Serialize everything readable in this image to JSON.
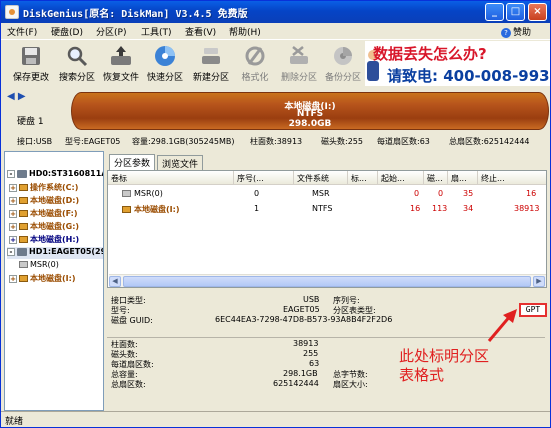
{
  "window": {
    "title": "DiskGenius[原名: DiskMan] V3.4.5 免费版",
    "controls": {
      "minimize": "_",
      "maximize": "□",
      "close": "×"
    }
  },
  "menu": {
    "items": [
      "文件(F)",
      "硬盘(D)",
      "分区(P)",
      "工具(T)",
      "查看(V)",
      "帮助(H)"
    ],
    "help_label": "赞助"
  },
  "toolbar": {
    "buttons": [
      {
        "label": "保存更改",
        "icon": "save-icon"
      },
      {
        "label": "搜索分区",
        "icon": "search-icon"
      },
      {
        "label": "恢复文件",
        "icon": "recover-icon"
      },
      {
        "label": "快速分区",
        "icon": "quick-partition-icon"
      },
      {
        "label": "新建分区",
        "icon": "new-partition-icon"
      },
      {
        "label": "格式化",
        "icon": "format-icon"
      },
      {
        "label": "删除分区",
        "icon": "delete-partition-icon"
      },
      {
        "label": "备份分区",
        "icon": "backup-icon"
      }
    ]
  },
  "ad": {
    "line1": "数据丢失怎么办?",
    "line2": "请致电: 400-008-993"
  },
  "diskbar": {
    "disk_label": "硬盘 1",
    "partition_name": "本地磁盘(I:)",
    "partition_fs": "NTFS",
    "partition_size": "298.0GB"
  },
  "disk_info": {
    "interface": "接口:USB",
    "model": "型号:EAGET05",
    "capacity": "容量:298.1GB(305245MB)",
    "cylinders": "柱面数:38913",
    "heads": "磁头数:255",
    "sectors_per_track": "每道扇区数:63",
    "total_sectors": "总扇区数:625142444"
  },
  "tree": {
    "items": [
      {
        "label": "HD0:ST3160811AS",
        "kind": "disk"
      },
      {
        "label": "操作系统(C:)",
        "kind": "partition"
      },
      {
        "label": "本地磁盘(D:)",
        "kind": "partition"
      },
      {
        "label": "本地磁盘(F:)",
        "kind": "partition"
      },
      {
        "label": "本地磁盘(G:)",
        "kind": "partition"
      },
      {
        "label": "本地磁盘(H:)",
        "kind": "partition"
      },
      {
        "label": "HD1:EAGET05(298",
        "kind": "disk"
      },
      {
        "label": "MSR(0)",
        "kind": "partition"
      },
      {
        "label": "本地磁盘(I:)",
        "kind": "partition"
      }
    ]
  },
  "tabs": [
    "分区参数",
    "浏览文件"
  ],
  "table": {
    "headers": [
      "卷标",
      "序号(...",
      "文件系统",
      "标...",
      "起始...",
      "磁...",
      "扇...",
      "终止..."
    ],
    "rows": [
      {
        "label": "MSR(0)",
        "index": "0",
        "fs": "MSR",
        "flag": "",
        "start_cyl": "0",
        "start_head": "0",
        "start_sector": "35",
        "end": "16"
      },
      {
        "label": "本地磁盘(I:)",
        "index": "1",
        "fs": "NTFS",
        "flag": "",
        "start_cyl": "16",
        "start_head": "113",
        "start_sector": "34",
        "end": "38913"
      }
    ]
  },
  "details": {
    "interface_type_label": "接口类型:",
    "interface_type_value": "USB",
    "serial_label": "序列号:",
    "model_label": "型号:",
    "model_value": "EAGET05",
    "partition_table_label": "分区表类型:",
    "partition_table_value": "GPT",
    "guid_label": "磁盘 GUID:",
    "guid_value": "6EC44EA3-7298-47D8-B573-93A8B4F2F2D6",
    "cylinders_label": "柱面数:",
    "cylinders_value": "38913",
    "heads_label": "磁头数:",
    "heads_value": "255",
    "spt_label": "每道扇区数:",
    "spt_value": "63",
    "capacity_label": "总容量:",
    "capacity_value": "298.1GB",
    "total_bytes_label": "总字节数:",
    "total_sectors_label": "总扇区数:",
    "total_sectors_value": "625142444",
    "sector_size_label": "扇区大小:"
  },
  "annotation": {
    "line1": "此处标明分区",
    "line2": "表格式",
    "color": "#e02020"
  },
  "status": {
    "text": "就绪"
  }
}
